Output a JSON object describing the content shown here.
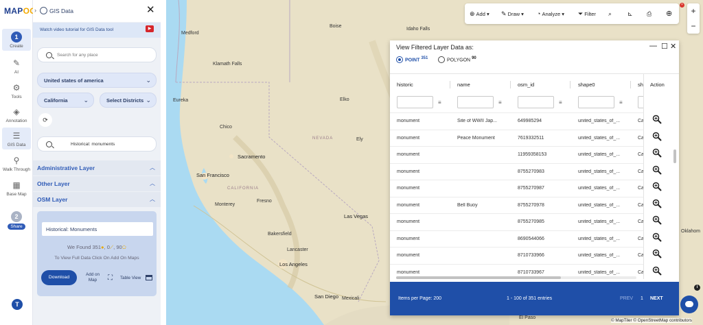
{
  "brand": {
    "prefix": "MAP",
    "suffix": "OG"
  },
  "rail": {
    "step1": "1",
    "create": "Create",
    "ai": "AI",
    "tools": "Tools",
    "annotation": "Annotation",
    "gis_data": "GIS Data",
    "walk_through": "Walk Through",
    "base_map": "Base Map",
    "step2": "2",
    "share": "Share",
    "avatar": "T"
  },
  "panel": {
    "title": "GIS Data",
    "tutorial": "Watch video tutorial for GIS Data tool",
    "search_placeholder": "Search for any place",
    "country": "United states of america",
    "state": "California",
    "districts": "Select Districts",
    "layer_search": "Historical: monuments",
    "sections": [
      "Administrative Layer",
      "Other Layer",
      "OSM Layer"
    ],
    "osm": {
      "name": "Historical: Monuments",
      "found_label": "We Found",
      "points": "351",
      "lines": "0",
      "polygons": "90",
      "hint": "To View Full Data Click On Add On Maps",
      "download": "Download",
      "add_on_map": "Add on Map",
      "table_view": "Table View"
    }
  },
  "toolbar": {
    "add": "Add",
    "draw": "Draw",
    "analyze": "Analyze",
    "filter": "Filter",
    "badge": "×"
  },
  "zoom": {
    "in": "+",
    "out": "−"
  },
  "map_labels": {
    "boise": "Boise",
    "idaho_falls": "Idaho Falls",
    "medford": "Medford",
    "klamath_falls": "Klamath Falls",
    "eureka": "Eureka",
    "elko": "Elko",
    "chico": "Chico",
    "ely": "Ely",
    "sacramento": "Sacramento",
    "nevada": "NEVADA",
    "san_francisco": "San Francisco",
    "california": "CALIFORNIA",
    "monterey": "Monterey",
    "fresno": "Fresno",
    "las_vegas": "Las Vegas",
    "bakersfield": "Bakersfield",
    "lancaster": "Lancaster",
    "los_angeles": "Los Angeles",
    "san_diego": "San Diego",
    "mexicali": "Mexicali",
    "el_paso": "El Paso",
    "oklahoma": "Oklahom"
  },
  "filter_window": {
    "title": "View Filtered Layer Data as:",
    "point_label": "POINT",
    "point_count": "351",
    "polygon_label": "POLYGON",
    "polygon_count": "90",
    "columns": [
      "historic",
      "name",
      "osm_id",
      "shape0",
      "sh",
      "Action"
    ],
    "rows": [
      [
        "monument",
        "Site of WWII Jap...",
        "649985294",
        "united_states_of_...",
        "Ca"
      ],
      [
        "monument",
        "Peace Monument",
        "7619332511",
        "united_states_of_...",
        "Ca"
      ],
      [
        "monument",
        "",
        "11959358153",
        "united_states_of_...",
        "Ca"
      ],
      [
        "monument",
        "",
        "8755270983",
        "united_states_of_...",
        "Ca"
      ],
      [
        "monument",
        "",
        "8755270987",
        "united_states_of_...",
        "Ca"
      ],
      [
        "monument",
        "Bell Buoy",
        "8755270978",
        "united_states_of_...",
        "Ca"
      ],
      [
        "monument",
        "",
        "8755270985",
        "united_states_of_...",
        "Ca"
      ],
      [
        "monument",
        "",
        "8690544066",
        "united_states_of_...",
        "Ca"
      ],
      [
        "monument",
        "",
        "8710733966",
        "united_states_of_...",
        "Ca"
      ],
      [
        "monument",
        "",
        "8710733967",
        "united_states_of_...",
        "Ca"
      ]
    ],
    "items_per_page": "Items per Page: 200",
    "range": "1 - 100 of 351 entries",
    "prev": "PREV",
    "page": "1",
    "next": "NEXT"
  },
  "info": "i",
  "attribution": "© MapTiler © OpenStreetMap contributors",
  "colors": {
    "accent": "#1f4fa8",
    "land": "#e9e1c7",
    "water": "#aadaf2"
  }
}
